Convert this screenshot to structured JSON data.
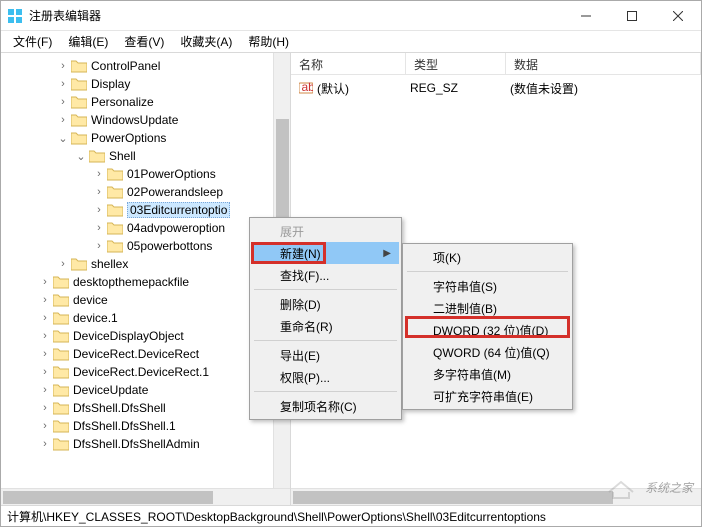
{
  "window": {
    "title": "注册表编辑器"
  },
  "menubar": [
    "文件(F)",
    "编辑(E)",
    "查看(V)",
    "收藏夹(A)",
    "帮助(H)"
  ],
  "tree": [
    {
      "d": 3,
      "t": ">",
      "l": "ControlPanel"
    },
    {
      "d": 3,
      "t": ">",
      "l": "Display"
    },
    {
      "d": 3,
      "t": ">",
      "l": "Personalize"
    },
    {
      "d": 3,
      "t": ">",
      "l": "WindowsUpdate"
    },
    {
      "d": 3,
      "t": "v",
      "l": "PowerOptions"
    },
    {
      "d": 4,
      "t": "v",
      "l": "Shell"
    },
    {
      "d": 5,
      "t": ">",
      "l": "01PowerOptions"
    },
    {
      "d": 5,
      "t": ">",
      "l": "02Powerandsleep"
    },
    {
      "d": 5,
      "t": ">",
      "l": "03Editcurrentoptio",
      "sel": true
    },
    {
      "d": 5,
      "t": ">",
      "l": "04advpoweroption"
    },
    {
      "d": 5,
      "t": ">",
      "l": "05powerbottons"
    },
    {
      "d": 3,
      "t": ">",
      "l": "shellex"
    },
    {
      "d": 2,
      "t": ">",
      "l": "desktopthemepackfile"
    },
    {
      "d": 2,
      "t": ">",
      "l": "device"
    },
    {
      "d": 2,
      "t": ">",
      "l": "device.1"
    },
    {
      "d": 2,
      "t": ">",
      "l": "DeviceDisplayObject"
    },
    {
      "d": 2,
      "t": ">",
      "l": "DeviceRect.DeviceRect"
    },
    {
      "d": 2,
      "t": ">",
      "l": "DeviceRect.DeviceRect.1"
    },
    {
      "d": 2,
      "t": ">",
      "l": "DeviceUpdate"
    },
    {
      "d": 2,
      "t": ">",
      "l": "DfsShell.DfsShell"
    },
    {
      "d": 2,
      "t": ">",
      "l": "DfsShell.DfsShell.1"
    },
    {
      "d": 2,
      "t": ">",
      "l": "DfsShell.DfsShellAdmin"
    }
  ],
  "list": {
    "headers": {
      "name": "名称",
      "type": "类型",
      "data": "数据"
    },
    "rows": [
      {
        "icon": "string",
        "name": "(默认)",
        "type": "REG_SZ",
        "data": "(数值未设置)"
      }
    ]
  },
  "context_main": [
    {
      "label": "展开",
      "disabled": true
    },
    {
      "label": "新建(N)",
      "hl": true,
      "sub": true
    },
    {
      "label": "查找(F)..."
    },
    {
      "sep": true
    },
    {
      "label": "删除(D)"
    },
    {
      "label": "重命名(R)"
    },
    {
      "sep": true
    },
    {
      "label": "导出(E)"
    },
    {
      "label": "权限(P)..."
    },
    {
      "sep": true
    },
    {
      "label": "复制项名称(C)"
    }
  ],
  "context_sub": [
    {
      "label": "项(K)"
    },
    {
      "sep": true
    },
    {
      "label": "字符串值(S)"
    },
    {
      "label": "二进制值(B)"
    },
    {
      "label": "DWORD (32 位)值(D)",
      "hl": false
    },
    {
      "label": "QWORD (64 位)值(Q)"
    },
    {
      "label": "多字符串值(M)"
    },
    {
      "label": "可扩充字符串值(E)"
    }
  ],
  "statusbar": "计算机\\HKEY_CLASSES_ROOT\\DesktopBackground\\Shell\\PowerOptions\\Shell\\03Editcurrentoptions",
  "watermark": "系统之家"
}
